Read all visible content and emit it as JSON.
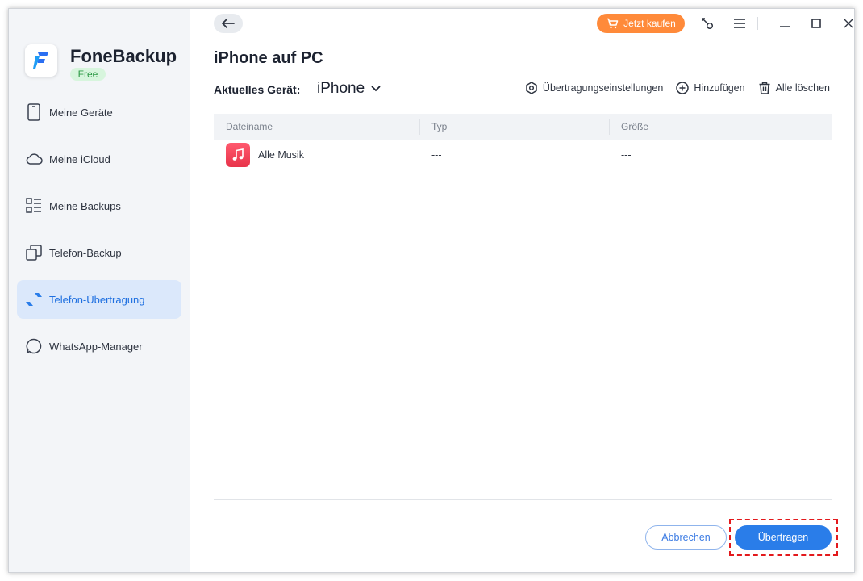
{
  "app": {
    "name": "FoneBackup",
    "badge": "Free"
  },
  "sidebar": {
    "items": [
      {
        "label": "Meine Geräte",
        "icon": "phone-icon",
        "active": false
      },
      {
        "label": "Meine iCloud",
        "icon": "cloud-icon",
        "active": false
      },
      {
        "label": "Meine Backups",
        "icon": "list-icon",
        "active": false
      },
      {
        "label": "Telefon-Backup",
        "icon": "copy-icon",
        "active": false
      },
      {
        "label": "Telefon-Übertragung",
        "icon": "transfer-icon",
        "active": true
      },
      {
        "label": "WhatsApp-Manager",
        "icon": "chat-bubble-icon",
        "active": false
      }
    ]
  },
  "titlebar": {
    "buy_label": "Jetzt kaufen"
  },
  "page": {
    "title": "iPhone auf PC",
    "device_label": "Aktuelles Gerät:",
    "device_value": "iPhone"
  },
  "actions": {
    "settings": "Übertragungseinstellungen",
    "add": "Hinzufügen",
    "clear": "Alle löschen"
  },
  "table": {
    "columns": [
      "Dateiname",
      "Typ",
      "Größe"
    ],
    "rows": [
      {
        "name": "Alle Musik",
        "type": "---",
        "size": "---",
        "icon": "music-icon"
      }
    ]
  },
  "footer": {
    "cancel_label": "Abbrechen",
    "transfer_label": "Übertragen"
  },
  "colors": {
    "accent": "#2a7de9",
    "buy": "#ff8a3a",
    "highlight": "#e3191c",
    "sidebar_bg": "#f3f5f8",
    "active_bg": "#dbe8fb"
  }
}
